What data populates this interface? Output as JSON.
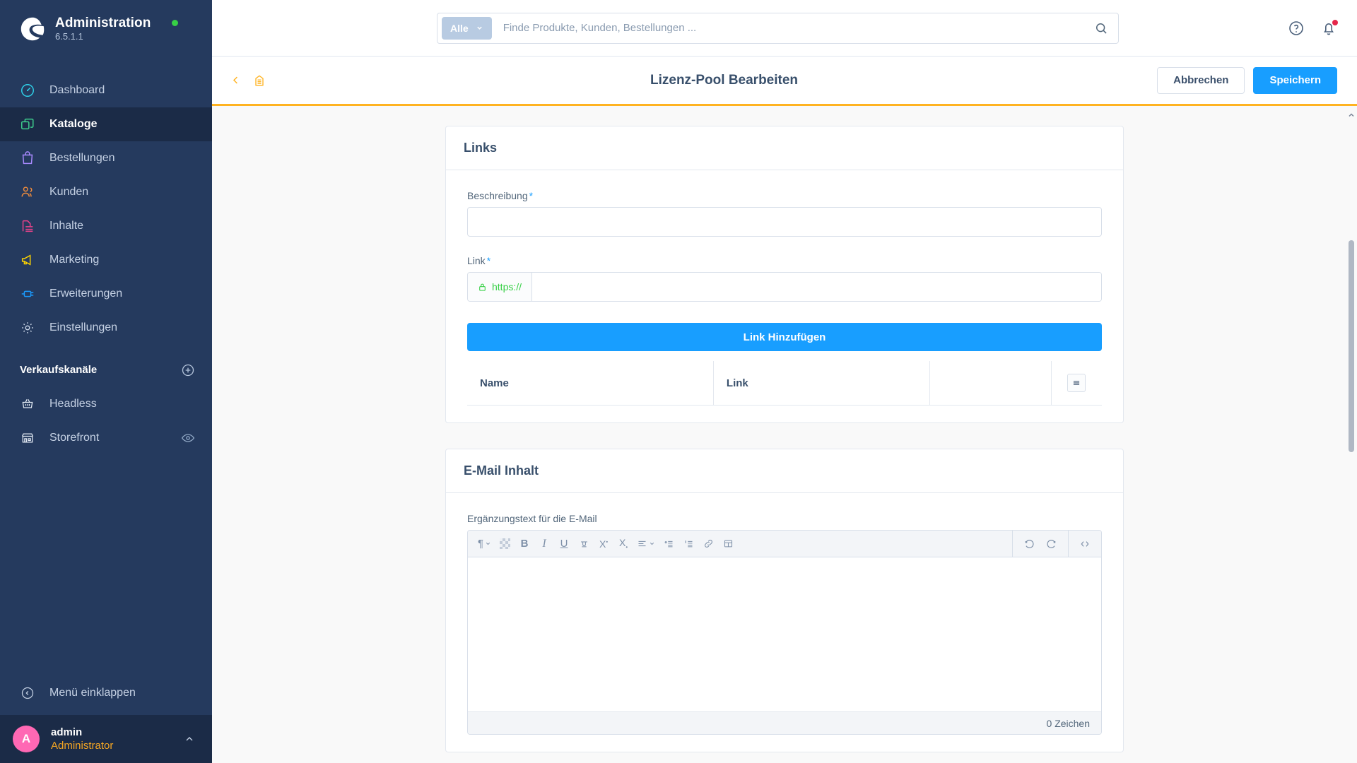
{
  "sidebar": {
    "brand": {
      "title": "Administration",
      "version": "6.5.1.1",
      "logo_icon": "shopware-logo-icon",
      "status_icon": "status-dot-online"
    },
    "nav": [
      {
        "label": "Dashboard",
        "icon": "dashboard-gauge-icon",
        "active": false
      },
      {
        "label": "Kataloge",
        "icon": "catalog-copy-icon",
        "active": true
      },
      {
        "label": "Bestellungen",
        "icon": "orders-bag-icon",
        "active": false
      },
      {
        "label": "Kunden",
        "icon": "customers-users-icon",
        "active": false
      },
      {
        "label": "Inhalte",
        "icon": "content-document-icon",
        "active": false
      },
      {
        "label": "Marketing",
        "icon": "marketing-megaphone-icon",
        "active": false
      },
      {
        "label": "Erweiterungen",
        "icon": "extensions-plug-icon",
        "active": false
      },
      {
        "label": "Einstellungen",
        "icon": "settings-gear-icon",
        "active": false
      }
    ],
    "sales_channels": {
      "heading": "Verkaufskanäle",
      "add_icon": "plus-circle-icon",
      "items": [
        {
          "label": "Headless",
          "icon": "basket-icon",
          "trailing_icon": null
        },
        {
          "label": "Storefront",
          "icon": "storefront-icon",
          "trailing_icon": "eye-icon"
        }
      ]
    },
    "collapse": {
      "label": "Menü einklappen",
      "icon": "collapse-left-icon"
    },
    "user": {
      "initial": "A",
      "name": "admin",
      "role": "Administrator",
      "caret_icon": "chevron-up-icon"
    }
  },
  "topbar": {
    "scope_label": "Alle",
    "scope_caret_icon": "chevron-down-icon",
    "search_placeholder": "Finde Produkte, Kunden, Bestellungen ...",
    "search_value": "",
    "search_icon": "search-icon",
    "help_icon": "help-circle-icon",
    "notifications_icon": "bell-icon",
    "notifications_badge": true
  },
  "pagehead": {
    "back_icon": "chevron-left-icon",
    "module_icon": "license-module-icon",
    "title": "Lizenz-Pool Bearbeiten",
    "cancel_label": "Abbrechen",
    "save_label": "Speichern"
  },
  "cards": {
    "links": {
      "title": "Links",
      "description_label": "Beschreibung",
      "description_required": "*",
      "description_value": "",
      "link_label": "Link",
      "link_required": "*",
      "link_prefix": "https://",
      "link_prefix_icon": "lock-icon",
      "link_value": "",
      "add_button_label": "Link Hinzufügen",
      "table": {
        "columns": [
          "Name",
          "Link",
          ""
        ],
        "settings_icon": "table-settings-icon",
        "rows": []
      }
    },
    "email": {
      "title": "E-Mail Inhalt",
      "field_label": "Ergänzungstext für die E-Mail",
      "editor_value": "",
      "char_count": "0 Zeichen",
      "toolbar_left": [
        {
          "name": "paragraph-format-icon",
          "glyph": "¶",
          "has_caret": true
        },
        {
          "name": "text-color-icon",
          "glyph": "",
          "has_caret": false
        },
        {
          "name": "bold-icon",
          "glyph": "B",
          "has_caret": false
        },
        {
          "name": "italic-icon",
          "glyph": "I",
          "has_caret": false
        },
        {
          "name": "underline-icon",
          "glyph": "U",
          "has_caret": false
        },
        {
          "name": "strikethrough-icon",
          "glyph": "S",
          "has_caret": false
        },
        {
          "name": "superscript-icon",
          "glyph": "X",
          "has_caret": false
        },
        {
          "name": "subscript-icon",
          "glyph": "X",
          "has_caret": false
        },
        {
          "name": "text-align-icon",
          "glyph": "",
          "has_caret": true
        },
        {
          "name": "bullet-list-icon",
          "glyph": "",
          "has_caret": false
        },
        {
          "name": "numbered-list-icon",
          "glyph": "",
          "has_caret": false
        },
        {
          "name": "link-icon",
          "glyph": "",
          "has_caret": false
        },
        {
          "name": "table-icon",
          "glyph": "",
          "has_caret": false
        }
      ],
      "toolbar_right": [
        {
          "name": "undo-icon"
        },
        {
          "name": "redo-icon"
        },
        {
          "name": "code-view-icon"
        }
      ]
    }
  },
  "colors": {
    "sidebar_bg": "#253a5e",
    "sidebar_active": "#1b2b47",
    "primary": "#189eff",
    "accent_yellow": "#ffb321",
    "avatar_pink": "#ff68b4",
    "role_orange": "#f5a623",
    "success_green": "#37d046",
    "danger_red": "#e5264a"
  }
}
